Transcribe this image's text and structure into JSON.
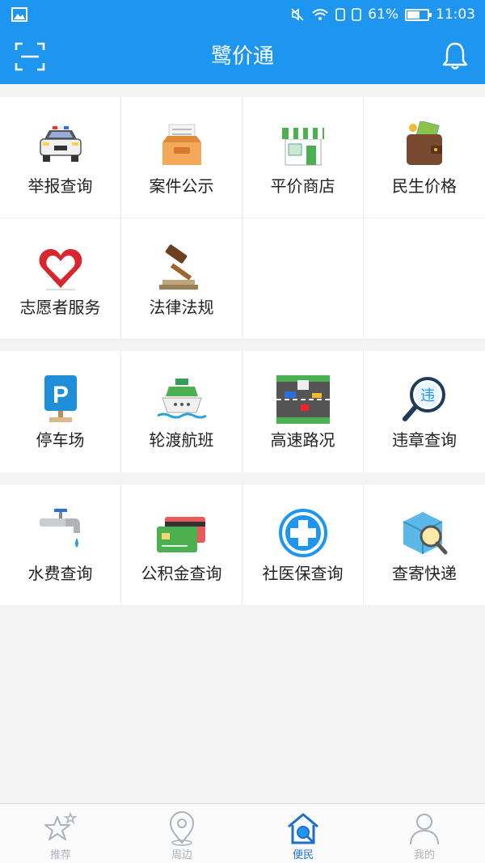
{
  "status_bar": {
    "battery": "61%",
    "battery_level": 0.61,
    "time": "11:03"
  },
  "nav": {
    "title": "鹭价通"
  },
  "sections": [
    {
      "items": [
        {
          "label": "举报查询",
          "icon": "police-car-icon"
        },
        {
          "label": "案件公示",
          "icon": "file-tray-icon"
        },
        {
          "label": "平价商店",
          "icon": "store-icon"
        },
        {
          "label": "民生价格",
          "icon": "wallet-money-icon"
        },
        {
          "label": "志愿者服务",
          "icon": "heart-hand-icon"
        },
        {
          "label": "法律法规",
          "icon": "gavel-icon"
        }
      ]
    },
    {
      "items": [
        {
          "label": "停车场",
          "icon": "parking-sign-icon"
        },
        {
          "label": "轮渡航班",
          "icon": "ferry-icon"
        },
        {
          "label": "高速路况",
          "icon": "road-traffic-icon"
        },
        {
          "label": "违章查询",
          "icon": "violation-search-icon"
        }
      ]
    },
    {
      "items": [
        {
          "label": "水费查询",
          "icon": "water-tap-icon"
        },
        {
          "label": "公积金查询",
          "icon": "bank-card-icon"
        },
        {
          "label": "社医保查询",
          "icon": "medical-cross-icon"
        },
        {
          "label": "查寄快递",
          "icon": "package-search-icon"
        }
      ]
    }
  ],
  "tabs": [
    {
      "label": "推荐",
      "icon": "star-icon",
      "active": false
    },
    {
      "label": "周边",
      "icon": "location-pin-icon",
      "active": false
    },
    {
      "label": "便民",
      "icon": "home-search-icon",
      "active": true
    },
    {
      "label": "我的",
      "icon": "user-icon",
      "active": false
    }
  ],
  "colors": {
    "primary": "#1e96f0",
    "active_tab": "#1f6fc8",
    "inactive_tab": "#aab2bc",
    "background": "#f3f3f3"
  }
}
